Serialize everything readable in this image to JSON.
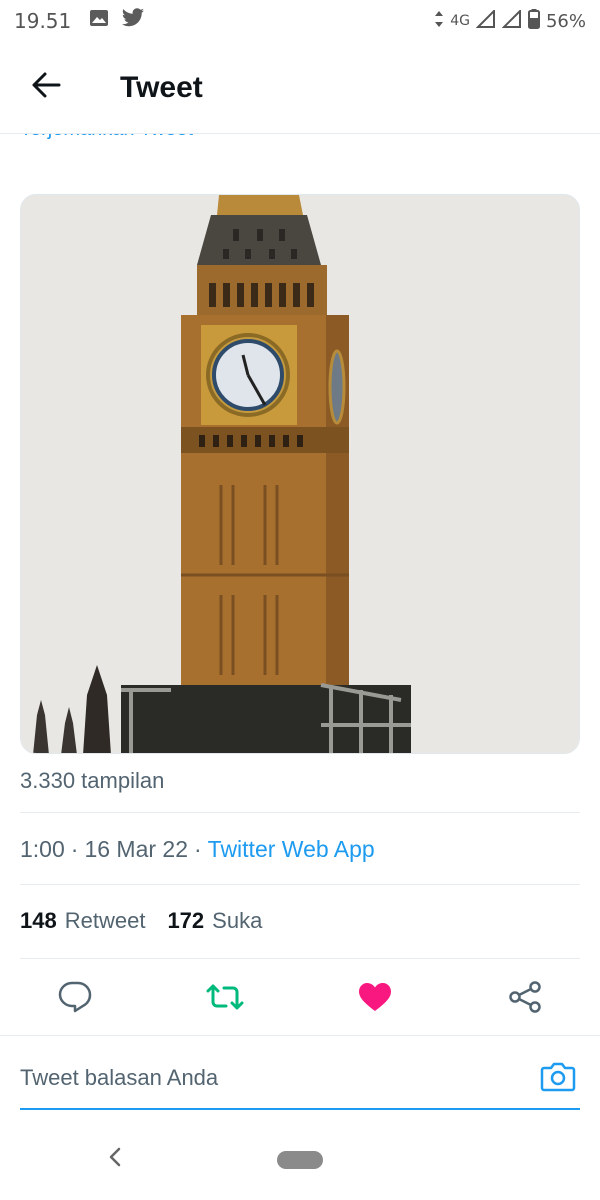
{
  "status_bar": {
    "time": "19.51",
    "network": "4G",
    "battery": "56%",
    "left_icons": [
      "image-icon",
      "twitter-icon"
    ],
    "right_icons": [
      "data-arrows-icon",
      "signal-icon",
      "signal-icon",
      "battery-icon"
    ]
  },
  "header": {
    "title": "Tweet",
    "back_icon": "arrow-left-icon"
  },
  "tweet": {
    "translate_label": "Terjemahkan Tweet",
    "media": {
      "subject": "photo",
      "icon": "image"
    },
    "views_label": "3.330 tampilan",
    "time": "1:00",
    "date": "16 Mar 22",
    "separator": "·",
    "source": "Twitter Web App",
    "retweet_count": "148",
    "retweet_label": "Retweet",
    "like_count": "172",
    "like_label": "Suka"
  },
  "actions": {
    "icons": [
      "reply-icon",
      "retweet-icon",
      "like-icon",
      "share-icon"
    ],
    "retweet_color": "#00ba7c",
    "like_color": "#f91880",
    "default_color": "#536471"
  },
  "reply": {
    "placeholder": "Tweet balasan Anda",
    "camera_icon": "camera-icon",
    "accent": "#1d9bf0"
  },
  "nav": {
    "back_icon": "chevron-left-icon",
    "home_icon": "home-pill-icon"
  }
}
